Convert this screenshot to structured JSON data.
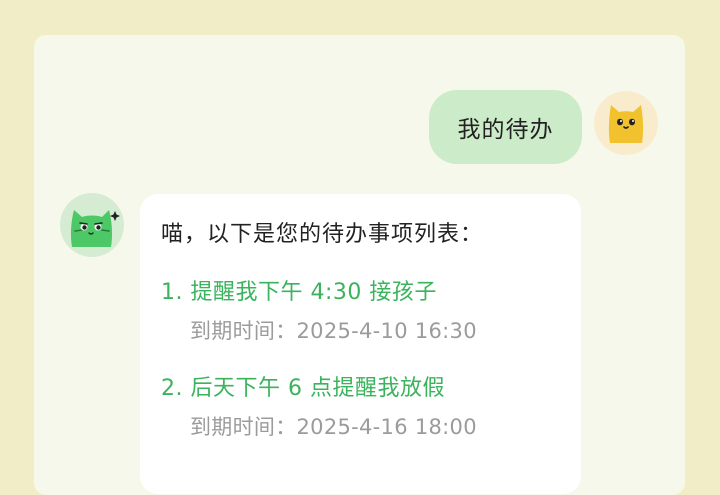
{
  "colors": {
    "page_background": "#f1edc6",
    "card_background": "#f7f8ec",
    "user_bubble": "#ccebc8",
    "bot_bubble": "#ffffff",
    "todo_title": "#3ab35c",
    "due_text": "#9b9b9b"
  },
  "chat": {
    "user_message": {
      "text": "我的待办",
      "avatar_icon": "yellow-cat-icon"
    },
    "bot_message": {
      "avatar_icon": "green-cat-icon",
      "intro": "喵，以下是您的待办事项列表：",
      "todos": [
        {
          "title": "1. 提醒我下午 4:30 接孩子",
          "due": "到期时间：2025-4-10 16:30"
        },
        {
          "title": "2. 后天下午 6 点提醒我放假",
          "due": "到期时间：2025-4-16 18:00"
        }
      ]
    }
  }
}
